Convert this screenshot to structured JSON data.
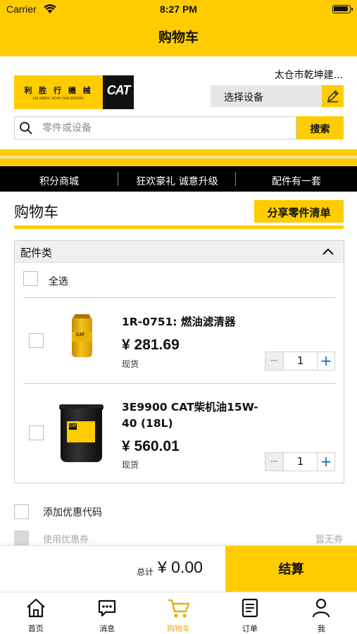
{
  "status_bar": {
    "carrier": "Carrier",
    "time": "8:27 PM"
  },
  "nav": {
    "title": "购物车"
  },
  "header": {
    "logo_cn": "利 胜 行 機 械",
    "logo_en": "LEI SHENG HONG MACHINERY",
    "logo_brand": "CAT",
    "dealer_name": "太仓市乾坤建...",
    "equipment_select": "选择设备",
    "search_placeholder": "零件或设备",
    "search_button": "搜索"
  },
  "promo_bar": [
    "积分商城",
    "狂欢豪礼 诚意升级",
    "配件有一套"
  ],
  "cart": {
    "title": "购物车",
    "share_button": "分享零件清单",
    "group_title": "配件类",
    "select_all": "全选",
    "items": [
      {
        "name": "1R-0751: 燃油滤清器",
        "price": "¥ 281.69",
        "stock": "现货",
        "qty": "1"
      },
      {
        "name": "3E9900 CAT柴机油15W-40 (18L)",
        "price": "¥ 560.01",
        "stock": "现货",
        "qty": "1"
      }
    ],
    "promo_code": "添加优惠代码",
    "use_coupon": "使用优惠券",
    "coupon_none": "暂无券"
  },
  "checkout_bar": {
    "total_label": "总计",
    "total_value": "¥ 0.00",
    "checkout_button": "结算"
  },
  "tabs": [
    {
      "label": "首页",
      "icon": "home-icon"
    },
    {
      "label": "消息",
      "icon": "message-icon"
    },
    {
      "label": "购物车",
      "icon": "cart-icon",
      "active": true
    },
    {
      "label": "订单",
      "icon": "orders-icon"
    },
    {
      "label": "我",
      "icon": "profile-icon"
    }
  ],
  "colors": {
    "brand_yellow": "#FFCC00",
    "active_tab": "#E8B000",
    "plus_blue": "#0a66c2"
  }
}
